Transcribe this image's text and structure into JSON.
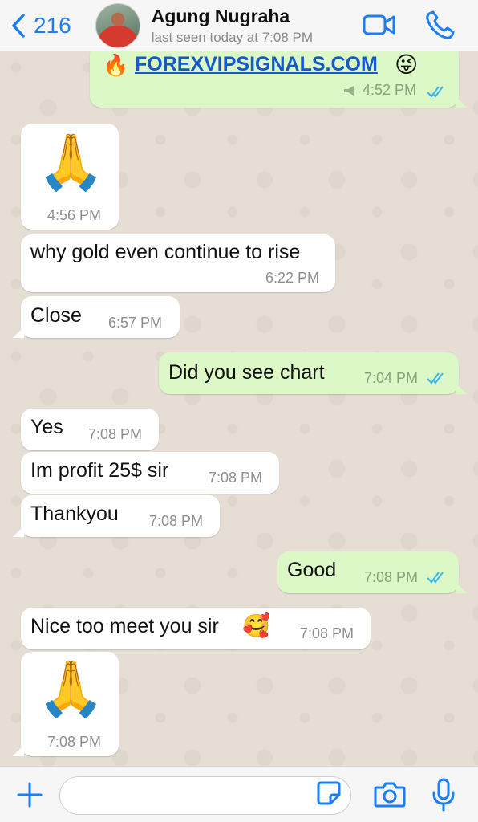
{
  "header": {
    "back_count": "216",
    "contact_name": "Agung Nugraha",
    "status": "last seen today at 7:08 PM"
  },
  "messages": [
    {
      "dir": "out",
      "type": "link",
      "prefix_emoji": "🔥",
      "text": "FOREXVIPSIGNALS.COM",
      "suffix_emoji": "😜",
      "time": "4:52 PM",
      "ticks": "read"
    },
    {
      "dir": "in",
      "type": "emoji",
      "emoji": "🙏",
      "time": "4:56 PM"
    },
    {
      "dir": "in",
      "type": "text",
      "text": "why gold even continue to rise",
      "time": "6:22 PM"
    },
    {
      "dir": "in",
      "type": "text",
      "text": "Close",
      "time": "6:57 PM"
    },
    {
      "dir": "out",
      "type": "text",
      "text": "Did you see chart",
      "time": "7:04 PM",
      "ticks": "read"
    },
    {
      "dir": "in",
      "type": "text",
      "text": "Yes",
      "time": "7:08 PM"
    },
    {
      "dir": "in",
      "type": "text",
      "text": "Im profit 25$ sir",
      "time": "7:08 PM"
    },
    {
      "dir": "in",
      "type": "text",
      "text": "Thankyou",
      "time": "7:08 PM"
    },
    {
      "dir": "out",
      "type": "text",
      "text": "Good",
      "time": "7:08 PM",
      "ticks": "read"
    },
    {
      "dir": "in",
      "type": "text",
      "text": "Nice too meet you sir",
      "suffix_emoji": "🥰",
      "time": "7:08 PM"
    },
    {
      "dir": "in",
      "type": "emoji",
      "emoji": "🙏",
      "time": "7:08 PM"
    }
  ],
  "input": {
    "value": "",
    "placeholder": ""
  },
  "colors": {
    "accent": "#1a7ef7",
    "outgoing_bubble": "#dcf8c6",
    "incoming_bubble": "#ffffff",
    "read_ticks": "#34b7f1"
  },
  "icons": [
    "chevron-left-icon",
    "video-call-icon",
    "phone-icon",
    "plus-icon",
    "sticker-icon",
    "camera-icon",
    "microphone-icon",
    "double-check-icon",
    "megaphone-icon"
  ]
}
